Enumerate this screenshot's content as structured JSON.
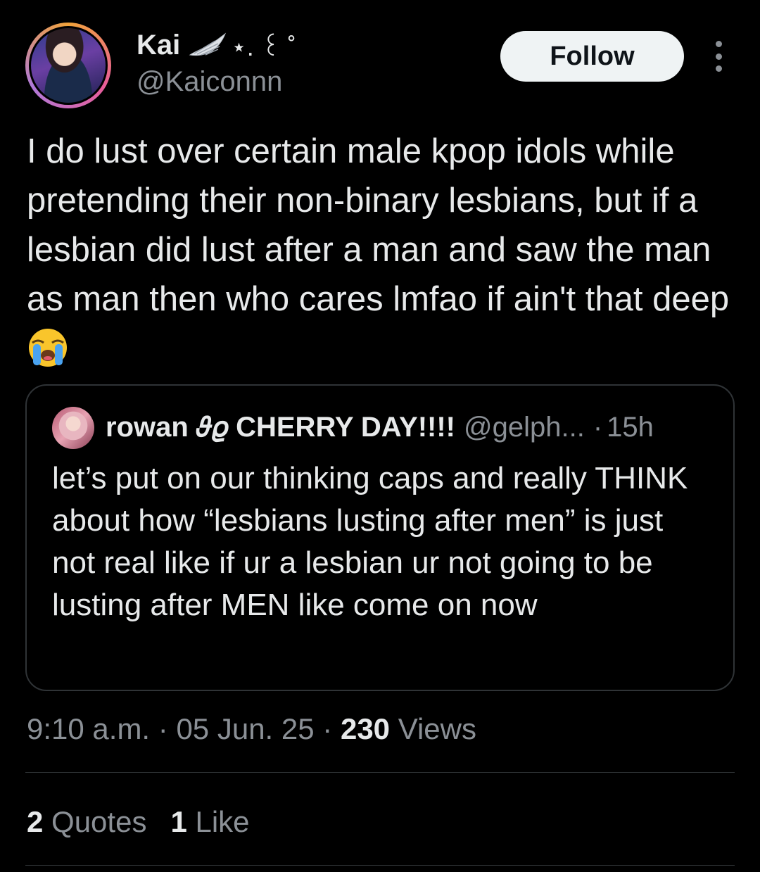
{
  "author": {
    "display_name": "Kai",
    "name_decoration": "⋆. ꒰ ˚",
    "handle": "@Kaiconnn"
  },
  "follow_label": "Follow",
  "tweet_text": "I do lust over certain male kpop idols while pretending their non-binary lesbians, but if a lesbian did lust after a man and saw the man as man then who cares lmfao if ain't that deep",
  "emoji": "loudly-crying-face",
  "quote": {
    "name": "rowan 𝜗𝜚 CHERRY DAY!!!!",
    "handle": "@gelph...",
    "separator": "·",
    "time": "15h",
    "text": "let’s put on our thinking caps and really THINK about how “lesbians lusting after men” is just not real like if ur a lesbian ur not going to be lusting after MEN like come on now"
  },
  "meta": {
    "time": "9:10 a.m.",
    "sep1": "·",
    "date": "05 Jun. 25",
    "sep2": "·",
    "views_count": "230",
    "views_label": "Views"
  },
  "stats": {
    "quotes_count": "2",
    "quotes_label": "Quotes",
    "likes_count": "1",
    "likes_label": "Like"
  },
  "colors": {
    "background": "#000000",
    "text_primary": "#e7e9ea",
    "text_secondary": "#8b9096",
    "border": "#2f3336",
    "follow_button_bg": "#eff3f4"
  },
  "icons": [
    "angel-wing-icon",
    "more-options-icon",
    "loudly-crying-face-emoji"
  ]
}
